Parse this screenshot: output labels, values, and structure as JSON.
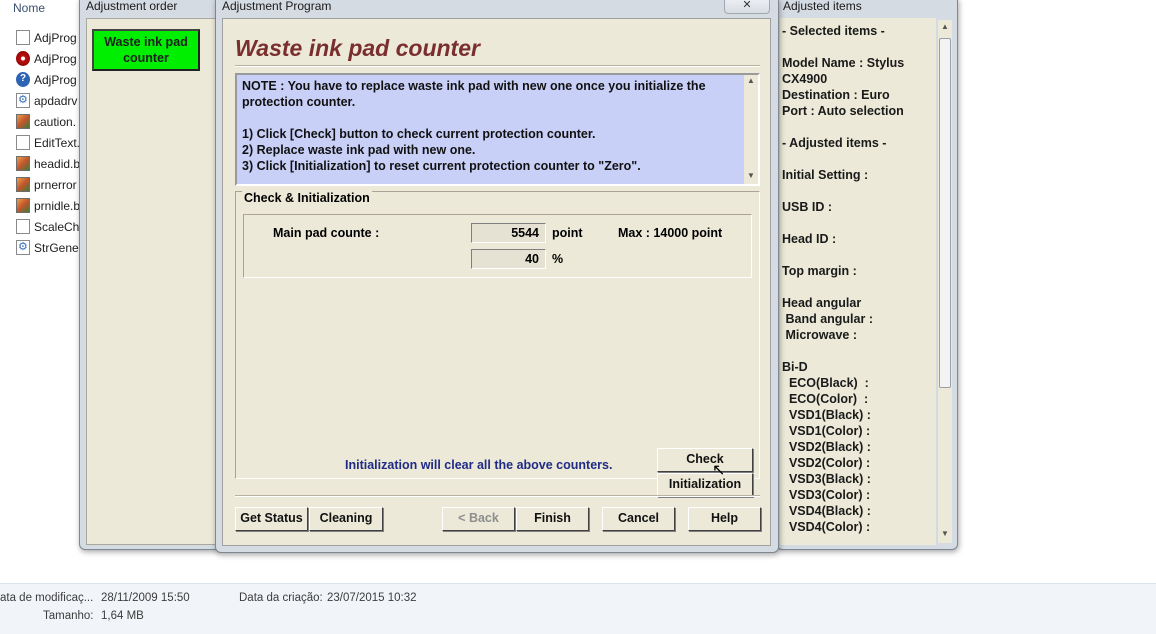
{
  "explorer": {
    "column_header": "Nome",
    "files": [
      {
        "name": "AdjProg",
        "icon": "document-icon"
      },
      {
        "name": "AdjProg",
        "icon": "app-red-icon"
      },
      {
        "name": "AdjProg",
        "icon": "help-icon"
      },
      {
        "name": "apdadrv",
        "icon": "settings-file-icon"
      },
      {
        "name": "caution.",
        "icon": "image-file-icon"
      },
      {
        "name": "EditText.",
        "icon": "document-icon"
      },
      {
        "name": "headid.b",
        "icon": "image-file-icon"
      },
      {
        "name": "prnerror",
        "icon": "image-file-icon"
      },
      {
        "name": "prnidle.b",
        "icon": "image-file-icon"
      },
      {
        "name": "ScaleChe",
        "icon": "document-icon"
      },
      {
        "name": "StrGene.",
        "icon": "settings-file-icon"
      }
    ],
    "status": {
      "modified_label": "ata de modificaç...",
      "modified_value": "28/11/2009 15:50",
      "created_label": "Data da criação:",
      "created_value": "23/07/2015 10:32",
      "size_label": "Tamanho:",
      "size_value": "1,64 MB"
    }
  },
  "order_window": {
    "title": "Adjustment order",
    "waste_button": "Waste ink pad counter"
  },
  "main_window": {
    "title": "Adjustment Program",
    "close_symbol": "✕",
    "heading": "Waste ink pad counter",
    "note": "NOTE : You have to replace waste ink pad with new one once you initialize the protection counter.\n\n1) Click [Check] button to check current protection counter.\n2) Replace waste ink pad with new one.\n3) Click [Initialization] to reset current protection counter to \"Zero\".",
    "group_title": "Check & Initialization",
    "main_pad_label": "Main pad counte :",
    "point_value": "5544",
    "point_unit": "point",
    "max_text": "Max : 14000 point",
    "percent_value": "40",
    "percent_unit": "%",
    "check_button": "Check",
    "init_button": "Initialization",
    "warning": "Initialization will clear all the above counters.",
    "buttons": {
      "get_status": "Get Status",
      "cleaning": "Cleaning",
      "back": "< Back",
      "finish": "Finish",
      "cancel": "Cancel",
      "help": "Help"
    }
  },
  "items_window": {
    "title": "Adjusted items",
    "text": "- Selected items -\n\nModel Name : Stylus\nCX4900\nDestination : Euro\nPort : Auto selection\n\n- Adjusted items -\n\nInitial Setting :\n\nUSB ID :\n\nHead ID :\n\nTop margin :\n\nHead angular\n Band angular :\n Microwave :\n\nBi-D\n  ECO(Black)  :\n  ECO(Color)  :\n  VSD1(Black) :\n  VSD1(Color) :\n  VSD2(Black) :\n  VSD2(Color) :\n  VSD3(Black) :\n  VSD3(Color) :\n  VSD4(Black) :\n  VSD4(Color) :"
  },
  "colors": {
    "green_button": "#00ee00",
    "heading": "#7a2f2f",
    "note_background": "#c8d0f8",
    "warning_text": "#1f2b85"
  }
}
